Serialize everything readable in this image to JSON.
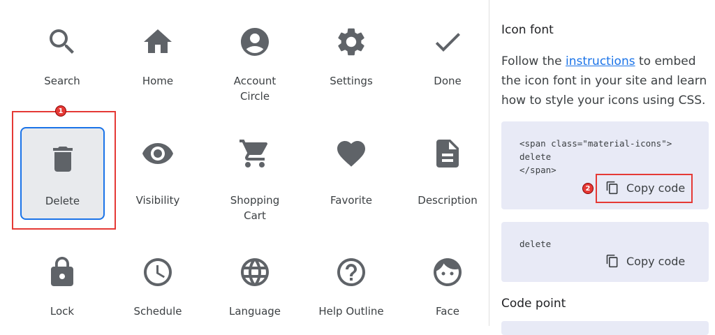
{
  "icon_grid": {
    "items": [
      {
        "label": "Search",
        "icon": "search-icon"
      },
      {
        "label": "Home",
        "icon": "home-icon"
      },
      {
        "label": "Account\nCircle",
        "icon": "account-circle-icon"
      },
      {
        "label": "Settings",
        "icon": "settings-icon"
      },
      {
        "label": "Done",
        "icon": "done-icon"
      },
      {
        "label": "Delete",
        "icon": "delete-icon"
      },
      {
        "label": "Visibility",
        "icon": "visibility-icon"
      },
      {
        "label": "Shopping\nCart",
        "icon": "shopping-cart-icon"
      },
      {
        "label": "Favorite",
        "icon": "favorite-icon"
      },
      {
        "label": "Description",
        "icon": "description-icon"
      },
      {
        "label": "Lock",
        "icon": "lock-icon"
      },
      {
        "label": "Schedule",
        "icon": "schedule-icon"
      },
      {
        "label": "Language",
        "icon": "language-icon"
      },
      {
        "label": "Help Outline",
        "icon": "help-outline-icon"
      },
      {
        "label": "Face",
        "icon": "face-icon"
      }
    ],
    "selected": "Delete"
  },
  "annotations": {
    "badge1": "1",
    "badge2": "2"
  },
  "side_panel": {
    "icon_font_title": "Icon font",
    "desc_before": "Follow the ",
    "desc_link": "instructions",
    "desc_after": " to embed the icon font in your site and learn how to style your icons using CSS.",
    "code_block_1": "<span class=\"material-icons\">\ndelete\n</span>",
    "code_block_2": "delete",
    "copy_label": "Copy code",
    "code_point_title": "Code point"
  },
  "colors": {
    "icon": "#5f6368",
    "selected_border": "#1a73e8",
    "annotation_red": "#e53935",
    "code_bg": "#e8eaf6",
    "link": "#1a73e8"
  }
}
